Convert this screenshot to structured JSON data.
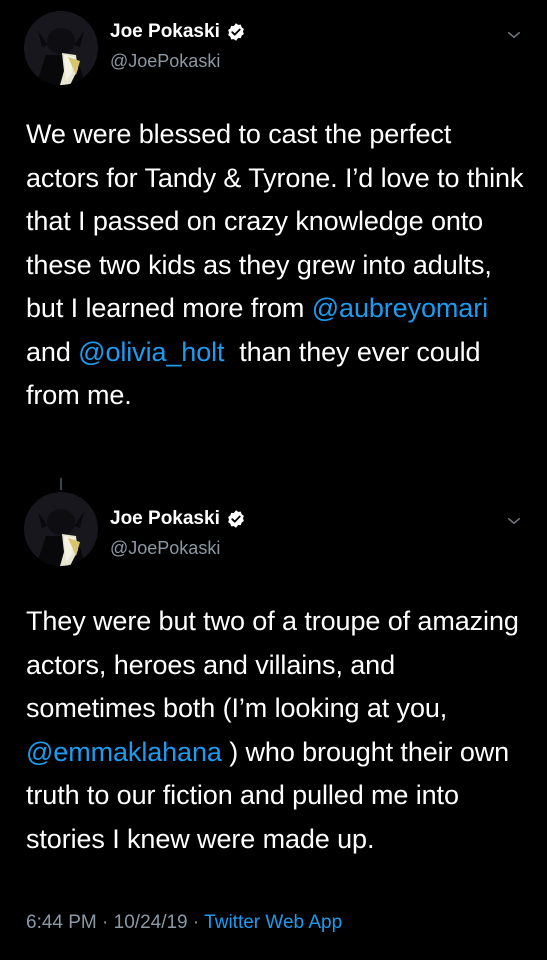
{
  "tweets": [
    {
      "author_name": "Joe Pokaski",
      "handle": "@JoePokaski",
      "body": {
        "t1": "We were blessed to cast the perfect actors for Tandy & Tyrone.  I’d love to think that I passed on crazy knowledge onto these two kids as they grew into adults, but I learned more from ",
        "m1": "@aubreyomari",
        "t2": "  and ",
        "m2": "@olivia_holt",
        "t3": "  than they ever could from me."
      }
    },
    {
      "author_name": "Joe Pokaski",
      "handle": "@JoePokaski",
      "body": {
        "t1": "They were but two of a troupe of amazing actors, heroes and villains, and sometimes both (I’m looking at you, ",
        "m1": "@emmaklahana",
        "t2": " ) who brought their own truth to our fiction and pulled me into stories I knew were made up."
      }
    }
  ],
  "meta": {
    "time": "6:44 PM",
    "sep1": " · ",
    "date": "10/24/19",
    "sep2": " · ",
    "source": "Twitter Web App"
  },
  "icons": {
    "verified": "verified-badge-icon",
    "more": "chevron-down-icon"
  },
  "colors": {
    "background": "#000000",
    "text": "#ffffff",
    "secondary": "#8b98a5",
    "link": "#1d9bf0"
  }
}
